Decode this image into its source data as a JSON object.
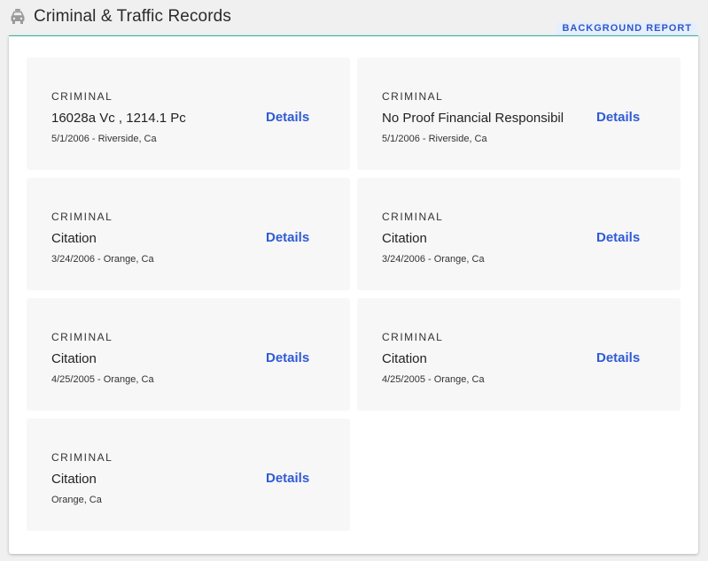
{
  "header": {
    "title": "Criminal & Traffic Records",
    "icon": "car-icon",
    "badge": "BACKGROUND REPORT"
  },
  "colors": {
    "accent_line": "#34b3a0",
    "link": "#2f5bd6",
    "badge_bg": "#e6efff",
    "card_bg": "#f7f7f7"
  },
  "records": [
    {
      "category": "CRIMINAL",
      "name": "16028a Vc , 1214.1 Pc",
      "meta": "5/1/2006 - Riverside, Ca",
      "action": "Details"
    },
    {
      "category": "CRIMINAL",
      "name": "No Proof Financial Responsibil",
      "meta": "5/1/2006 - Riverside, Ca",
      "action": "Details"
    },
    {
      "category": "CRIMINAL",
      "name": "Citation",
      "meta": "3/24/2006 - Orange, Ca",
      "action": "Details"
    },
    {
      "category": "CRIMINAL",
      "name": "Citation",
      "meta": "3/24/2006 - Orange, Ca",
      "action": "Details"
    },
    {
      "category": "CRIMINAL",
      "name": "Citation",
      "meta": "4/25/2005 - Orange, Ca",
      "action": "Details"
    },
    {
      "category": "CRIMINAL",
      "name": "Citation",
      "meta": "4/25/2005 - Orange, Ca",
      "action": "Details"
    },
    {
      "category": "CRIMINAL",
      "name": "Citation",
      "meta": "Orange, Ca",
      "action": "Details"
    }
  ]
}
